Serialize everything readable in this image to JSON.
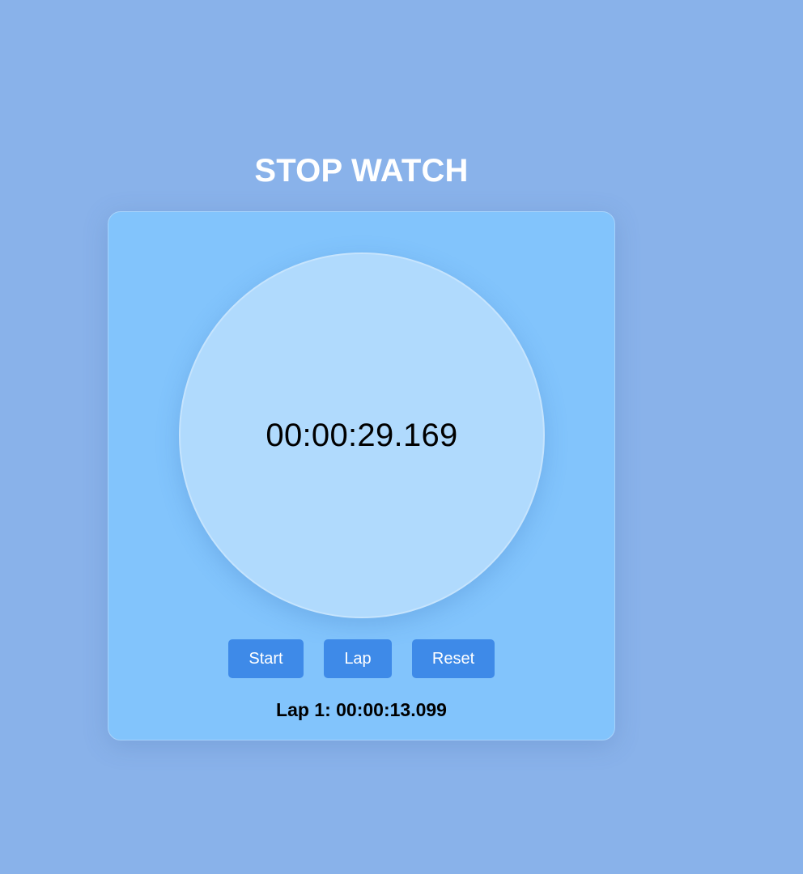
{
  "title": "STOP WATCH",
  "display": {
    "time": "00:00:29.169"
  },
  "controls": {
    "start_label": "Start",
    "lap_label": "Lap",
    "reset_label": "Reset"
  },
  "laps": [
    {
      "text": "Lap 1: 00:00:13.099"
    }
  ],
  "colors": {
    "page_background": "#89b2ea",
    "card_background": "#82c4fc",
    "dial_background": "#b0dafd",
    "button_background": "#3e8ae8",
    "title_color": "#ffffff"
  }
}
